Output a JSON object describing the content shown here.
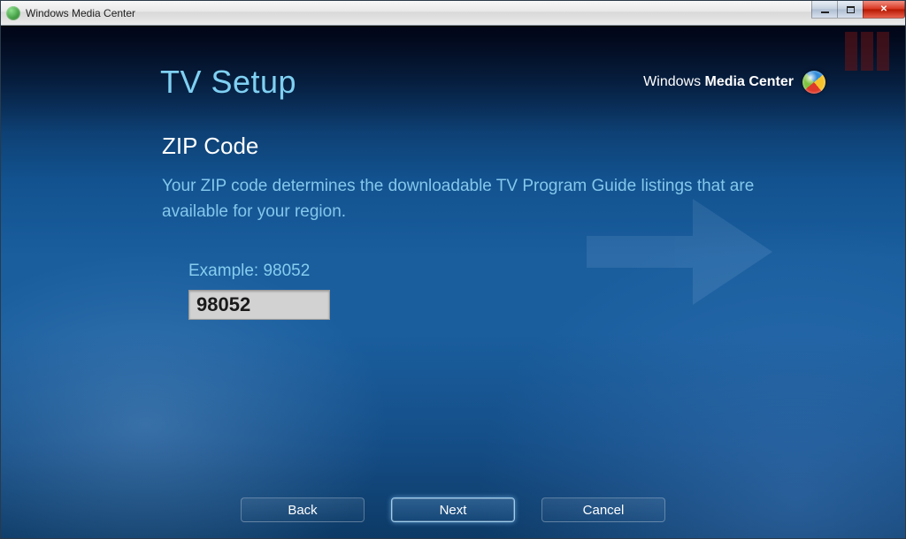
{
  "window": {
    "title": "Windows Media Center"
  },
  "brand": {
    "thin": "Windows",
    "bold": " Media Center"
  },
  "header": {
    "page_title": "TV Setup"
  },
  "main": {
    "section_title": "ZIP Code",
    "description": "Your ZIP code determines the downloadable TV Program Guide listings that are available for your region.",
    "example_label": "Example: 98052",
    "zip_value": "98052"
  },
  "footer": {
    "back": "Back",
    "next": "Next",
    "cancel": "Cancel"
  }
}
